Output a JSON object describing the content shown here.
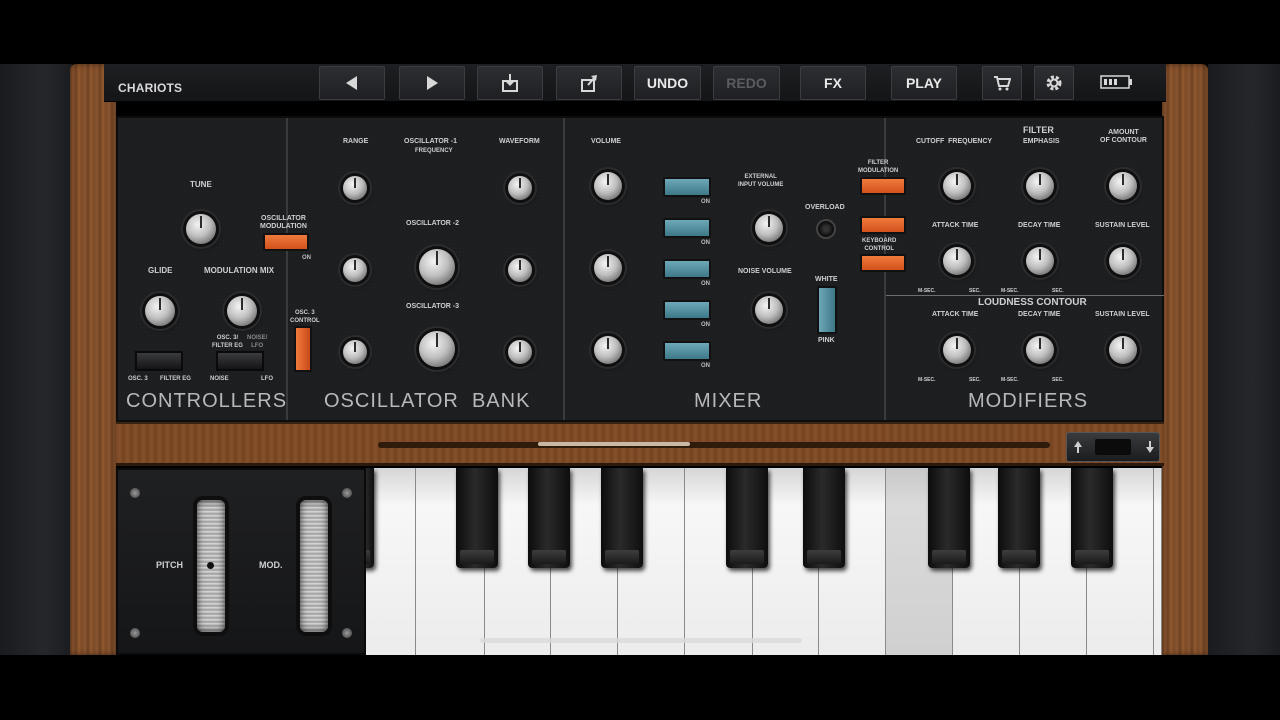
{
  "toolbar": {
    "preset_name": "CHARIOTS",
    "undo_label": "UNDO",
    "redo_label": "REDO",
    "fx_label": "FX",
    "play_label": "PLAY",
    "icons": [
      "previous-preset-icon",
      "next-preset-icon",
      "save-icon",
      "share-icon",
      "cart-icon",
      "gear-icon",
      "battery-icon"
    ]
  },
  "sections": {
    "controllers": "CONTROLLERS",
    "oscillator_bank": "OSCILLATOR  BANK",
    "mixer": "MIXER",
    "modifiers": "MODIFIERS"
  },
  "controllers": {
    "tune": "TUNE",
    "glide": "GLIDE",
    "modulation_mix": "MODULATION MIX",
    "oscillator_modulation": "OSCILLATOR\nMODULATION",
    "osc3_filter_eg_left": "OSC. 3",
    "osc3_filter_eg_right": "FILTER EG",
    "osc3_filter_eg": "OSC. 3/\nFILTER EG",
    "noise_lfo": "NOISE/\nLFO",
    "noise": "NOISE",
    "lfo": "LFO",
    "on": "ON"
  },
  "oscillator_bank": {
    "range": "RANGE",
    "osc1": "OSCILLATOR -1",
    "frequency": "FREQUENCY",
    "waveform": "WAVEFORM",
    "osc2": "OSCILLATOR -2",
    "osc3": "OSCILLATOR -3",
    "osc3_control": "OSC. 3\nCONTROL"
  },
  "mixer": {
    "volume": "VOLUME",
    "external_input_volume": "EXTERNAL\nINPUT VOLUME",
    "overload": "OVERLOAD",
    "noise_volume": "NOISE VOLUME",
    "white": "WHITE",
    "pink": "PINK",
    "on": "ON"
  },
  "modifiers": {
    "filter": "FILTER",
    "cutoff_frequency": "CUTOFF  FREQUENCY",
    "emphasis": "EMPHASIS",
    "amount_of_contour": "AMOUNT\nOF CONTOUR",
    "filter_modulation": "FILTER\nMODULATION",
    "keyboard_control": "KEYBOARD\nCONTROL",
    "attack_time": "ATTACK TIME",
    "decay_time": "DECAY TIME",
    "sustain_level": "SUSTAIN LEVEL",
    "loudness_contour": "LOUDNESS CONTOUR",
    "msec": "M-SEC.",
    "sec": "SEC."
  },
  "wheels": {
    "pitch": "PITCH",
    "mod": "MOD."
  }
}
